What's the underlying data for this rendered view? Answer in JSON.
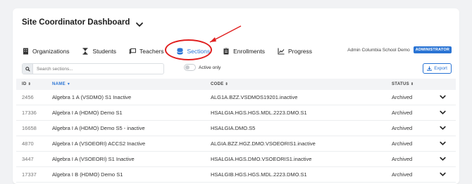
{
  "page": {
    "title": "Site Coordinator Dashboard"
  },
  "tabs": [
    {
      "label": "Organizations",
      "icon": "building-icon"
    },
    {
      "label": "Students",
      "icon": "hourglass-icon"
    },
    {
      "label": "Teachers",
      "icon": "chalkboard-icon"
    },
    {
      "label": "Sections",
      "icon": "layers-icon",
      "active": true
    },
    {
      "label": "Enrollments",
      "icon": "clipboard-icon"
    },
    {
      "label": "Progress",
      "icon": "chart-line-icon"
    }
  ],
  "user": {
    "name": "Admin Columbia School Demo",
    "role": "ADMINISTRATOR"
  },
  "toolbar": {
    "search_placeholder": "Search sections...",
    "active_only_label": "Active only",
    "export_label": "Export"
  },
  "table": {
    "headers": {
      "id": "ID",
      "name": "NAME",
      "code": "CODE",
      "status": "STATUS"
    },
    "rows": [
      {
        "id": "2456",
        "name": "Algebra 1 A (VSDMO) S1 Inactive",
        "code": "ALG1A.BZZ.VSDMOS19201.inactive",
        "status": "Archived"
      },
      {
        "id": "17336",
        "name": "Algebra I A (HDMO) Demo S1",
        "code": "HSALGIA.HGS.HGS.MDL.2223.DMO.S1",
        "status": "Archived"
      },
      {
        "id": "16658",
        "name": "Algebra I A (HDMO) Demo S5 - inactive",
        "code": "HSALGIA.DMO.S5",
        "status": "Archived"
      },
      {
        "id": "4870",
        "name": "Algebra I A (VSOEORI) ACCS2 Inactive",
        "code": "ALGIA.BZZ.HGZ.DMO.VSOEORIS1.inactive",
        "status": "Archived"
      },
      {
        "id": "3447",
        "name": "Algebra I A (VSOEORI) S1 Inactive",
        "code": "HSALGIA.HGS.DMO.VSOEORIS1.inactive",
        "status": "Archived"
      },
      {
        "id": "17337",
        "name": "Algebra I B (HDMO) Demo S1",
        "code": "HSALGIB.HGS.HGS.MDL.2223.DMO.S1",
        "status": "Archived"
      }
    ]
  },
  "colors": {
    "accent": "#2a74d4",
    "annotation": "#e01e1e",
    "header_bg": "#f3f4f6"
  }
}
